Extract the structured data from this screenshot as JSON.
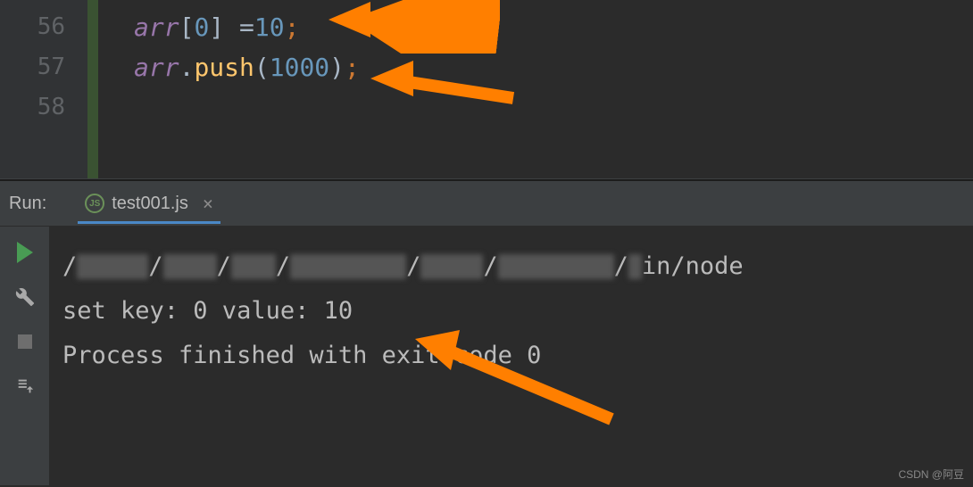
{
  "editor": {
    "lines": [
      {
        "num": "56"
      },
      {
        "num": "57"
      },
      {
        "num": "58"
      }
    ],
    "code": {
      "line1_var": "arr",
      "line1_idx": "0",
      "line1_val": "10",
      "line2_var": "arr",
      "line2_method": "push",
      "line2_arg": "1000"
    }
  },
  "run": {
    "label": "Run:",
    "tab_name": "test001.js",
    "close": "×"
  },
  "console": {
    "path_prefix": "/",
    "path_suffix": "in/node",
    "set_line": "set key: 0 value: 10",
    "blank": "",
    "exit_line": "Process finished with exit code 0"
  },
  "watermark": "CSDN @阿豆"
}
